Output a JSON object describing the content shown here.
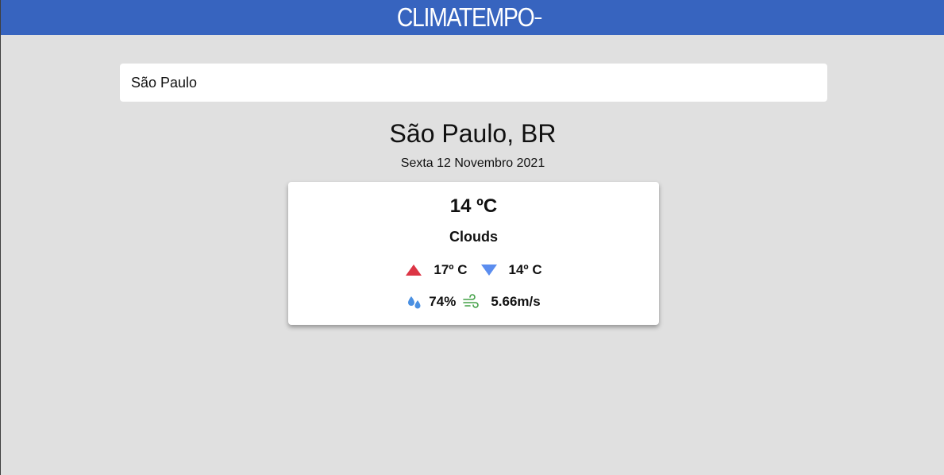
{
  "header": {
    "logo_text": "CLIMATEMPO",
    "background_color": "#3764bf"
  },
  "search": {
    "value": "São Paulo",
    "placeholder": ""
  },
  "location": {
    "name": "São Paulo, BR",
    "date": "Sexta 12 Novembro 2021"
  },
  "weather": {
    "temperature": "14 ºC",
    "condition": "Clouds",
    "max_temp": "17º C",
    "min_temp": "14º C",
    "humidity": "74%",
    "wind": "5.66m/s",
    "icons": {
      "max": "triangle-up-icon",
      "min": "triangle-down-icon",
      "humidity": "water-drops-icon",
      "wind": "wind-icon"
    },
    "colors": {
      "max": "#dc3545",
      "min": "#5b8def",
      "humidity": "#4a90e2",
      "wind": "#43a047"
    }
  }
}
